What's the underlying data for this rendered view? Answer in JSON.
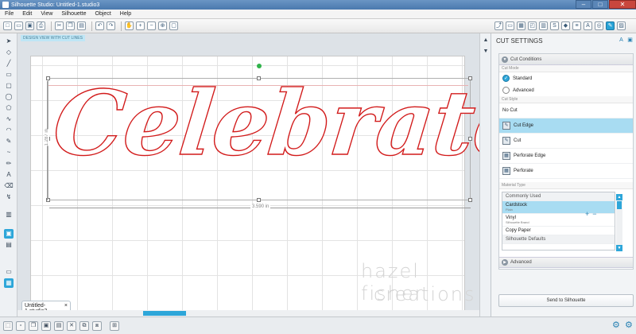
{
  "window": {
    "title": "Silhouette Studio: Untitled-1.studio3"
  },
  "menu": [
    "File",
    "Edit",
    "View",
    "Silhouette",
    "Object",
    "Help"
  ],
  "toolbar": {
    "icons": [
      "new-icon",
      "open-icon",
      "save-icon",
      "print-icon",
      "cut-icon",
      "copy-icon",
      "paste-icon",
      "undo-icon",
      "redo-icon",
      "pan-icon",
      "zoom-in-icon",
      "zoom-out-icon",
      "zoom-select-icon",
      "fit-page-icon"
    ],
    "right_icons": [
      "send-icon",
      "page-setup-icon",
      "grid-icon",
      "registration-icon",
      "library-icon",
      "store-icon",
      "fill-icon",
      "line-icon",
      "text-icon",
      "offset-icon",
      "send-to-silhouette-icon",
      "trace-icon"
    ]
  },
  "canvas": {
    "design_label": "DESIGN VIEW WITH CUT LINES",
    "text": "Celebrate",
    "width_label": "3.590 in",
    "height_label": "1.287 in"
  },
  "watermark": {
    "line1": "hazel fisher",
    "line2": "creations"
  },
  "document_tab": {
    "label": "Untitled-1.studio3",
    "close": "×"
  },
  "panel": {
    "title": "CUT SETTINGS",
    "cut_conditions": "Cut Conditions",
    "cut_mode_label": "Cut Mode",
    "standard": "Standard",
    "advanced_mode": "Advanced",
    "cut_style_label": "Cut Style",
    "cut_styles": [
      {
        "label": "No Cut",
        "selected": false
      },
      {
        "label": "Cut Edge",
        "selected": true
      },
      {
        "label": "Cut",
        "selected": false
      },
      {
        "label": "Perforate Edge",
        "selected": false
      },
      {
        "label": "Perforate",
        "selected": false
      }
    ],
    "material_type_label": "Material Type",
    "commonly_used": "Commonly Used",
    "materials": [
      {
        "name": "Cardstock",
        "sub": "Plain",
        "selected": true
      },
      {
        "name": "Vinyl",
        "sub": "Silhouette Brand",
        "selected": false
      },
      {
        "name": "Copy Paper",
        "sub": "",
        "selected": false
      }
    ],
    "silhouette_defaults": "Silhouette Defaults",
    "add_btn": "+",
    "remove_btn": "−",
    "advanced": "Advanced",
    "send_button": "Send to Silhouette"
  },
  "colors": {
    "accent": "#2da6d9",
    "cut_line": "#d21b1b"
  }
}
